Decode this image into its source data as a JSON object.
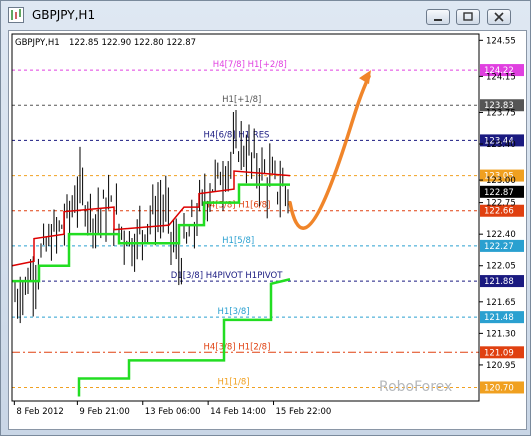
{
  "window": {
    "title": "GBPJPY,H1",
    "info_line": {
      "symbol": "GBPJPY,H1",
      "ohlc": "122.85 122.90 122.80 122.87"
    },
    "watermark": "RoboForex"
  },
  "chart_data": {
    "type": "candlestick",
    "price_axis_labels": [
      "124.55",
      "124.15",
      "123.75",
      "123.40",
      "123.00",
      "122.75",
      "122.40",
      "122.05",
      "121.65",
      "121.30",
      "120.95"
    ],
    "time_axis_labels": [
      "8 Feb 2012",
      "9 Feb 21:00",
      "13 Feb 06:00",
      "14 Feb 14:00",
      "15 Feb 22:00"
    ],
    "levels": [
      {
        "label": "H4[7/8] H1[+2/8]",
        "price": 124.22,
        "price_label": "124.22",
        "color": "#e040e0",
        "style": "dash",
        "label_x": 0.43
      },
      {
        "label": "H1[+1/8]",
        "price": 123.83,
        "price_label": "123.83",
        "color": "#555555",
        "style": "dash",
        "label_x": 0.45
      },
      {
        "label": "H4[6/8] H1 RES",
        "price": 123.44,
        "price_label": "123.44",
        "color": "#1a1a80",
        "style": "dash",
        "label_x": 0.41
      },
      {
        "label": "",
        "price": 123.05,
        "price_label": "123.05",
        "color": "#f0a020",
        "style": "dash",
        "label_x": 0.5
      },
      {
        "label": "H4[5/8] H1[6/8]",
        "price": 122.66,
        "price_label": "122.66",
        "color": "#e04010",
        "style": "dash",
        "label_x": 0.41
      },
      {
        "label": "H1[5/8]",
        "price": 122.27,
        "price_label": "122.27",
        "color": "#2aa0d0",
        "style": "dash",
        "label_x": 0.45
      },
      {
        "label": "D1[3/8] H4PIVOT H1PIVOT",
        "price": 121.88,
        "price_label": "121.88",
        "color": "#1a1a80",
        "style": "dash",
        "label_x": 0.34
      },
      {
        "label": "H1[3/8]",
        "price": 121.48,
        "price_label": "121.48",
        "color": "#2aa0d0",
        "style": "dash",
        "label_x": 0.44
      },
      {
        "label": "H4[3/8] H1[2/8]",
        "price": 121.09,
        "price_label": "121.09",
        "color": "#e04010",
        "style": "dashdot",
        "label_x": 0.41
      },
      {
        "label": "H1[1/8]",
        "price": 120.7,
        "price_label": "120.70",
        "color": "#f0a020",
        "style": "dash",
        "label_x": 0.44
      }
    ],
    "current_price": {
      "price": 122.87,
      "label": "122.87"
    },
    "price_range": [
      120.55,
      124.62
    ],
    "arrow_color": "#f0852a",
    "line_color_green": "#22dd22",
    "line_color_red": "#dd0000"
  }
}
